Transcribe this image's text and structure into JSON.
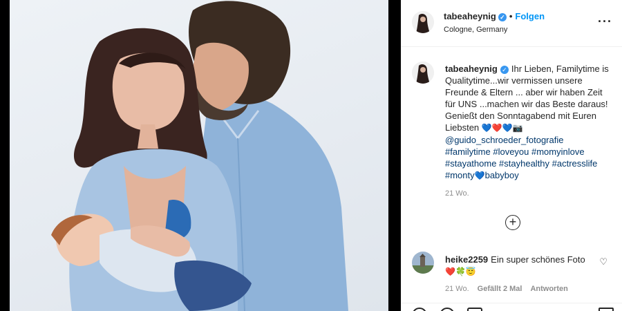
{
  "post": {
    "username": "tabeaheynig",
    "follow_label": "Folgen",
    "location": "Cologne, Germany"
  },
  "caption": {
    "username": "tabeaheynig",
    "text": "Ihr Lieben, Familytime is Qualitytime...wir vermissen unsere Freunde & Eltern ... aber wir haben Zeit für UNS ...machen wir das Beste daraus! Genießt den Sonntagabend mit Euren Liebsten",
    "emojis": "💙❤️💙📷",
    "mention": "@guido_schroeder_fotografie",
    "hashtags_line1": "#familytime #loveyou #momyinlove",
    "hashtags_line2": "#stayathome #stayhealthy #actresslife",
    "tag_monty": "#monty",
    "heart_blue": "💙",
    "tag_babyboy": "babyboy",
    "time": "21 Wo."
  },
  "comment": {
    "username": "heike2259",
    "text": "Ein super schönes Foto",
    "emojis": "❤️🍀😇",
    "time": "21 Wo.",
    "likes": "Gefällt 2 Mal",
    "reply_label": "Antworten"
  },
  "icons": {
    "more": "more-options-icon",
    "add": "plus-circle-icon",
    "like": "heart-outline-icon",
    "verified": "verified-badge-icon"
  },
  "colors": {
    "link": "#00376b",
    "follow": "#0095f6",
    "verified": "#3897f0",
    "meta": "#8e8e8e"
  }
}
